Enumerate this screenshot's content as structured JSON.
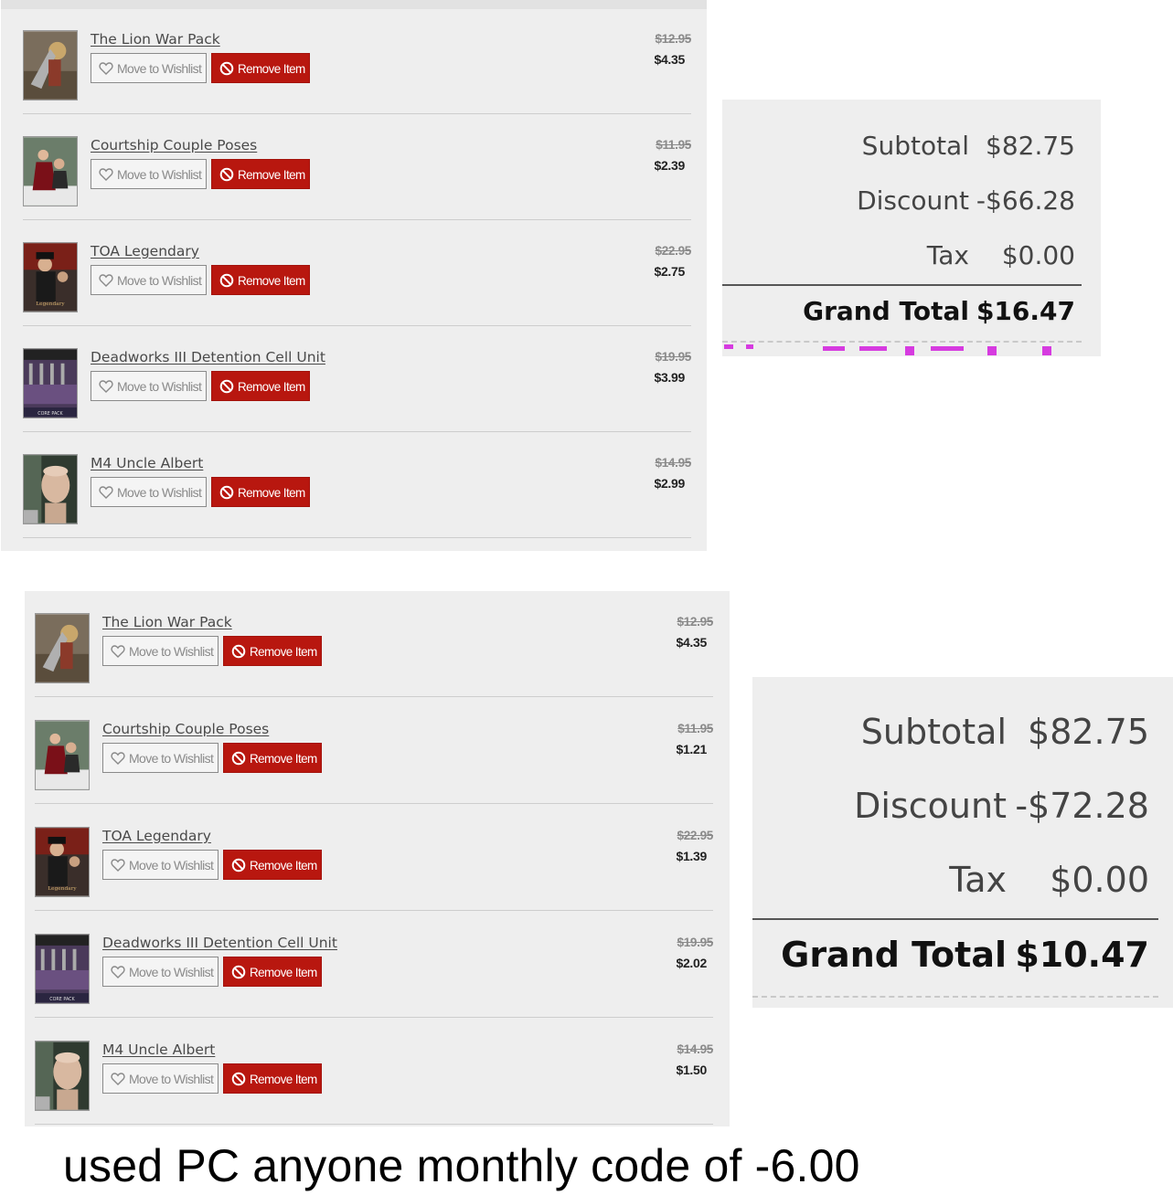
{
  "carts": [
    {
      "items": [
        {
          "title": "The Lion War Pack",
          "original_price": "$12.95",
          "sale_price": "$4.35",
          "thumb": "lion-war-thumb"
        },
        {
          "title": "Courtship Couple Poses",
          "original_price": "$11.95",
          "sale_price": "$2.39",
          "thumb": "courtship-thumb"
        },
        {
          "title": "TOA Legendary",
          "original_price": "$22.95",
          "sale_price": "$2.75",
          "thumb": "toa-thumb"
        },
        {
          "title": "Deadworks III Detention Cell Unit",
          "original_price": "$19.95",
          "sale_price": "$3.99",
          "thumb": "deadworks-thumb"
        },
        {
          "title": "M4 Uncle Albert",
          "original_price": "$14.95",
          "sale_price": "$2.99",
          "thumb": "albert-thumb"
        }
      ]
    },
    {
      "items": [
        {
          "title": "The Lion War Pack",
          "original_price": "$12.95",
          "sale_price": "$4.35",
          "thumb": "lion-war-thumb"
        },
        {
          "title": "Courtship Couple Poses",
          "original_price": "$11.95",
          "sale_price": "$1.21",
          "thumb": "courtship-thumb"
        },
        {
          "title": "TOA Legendary",
          "original_price": "$22.95",
          "sale_price": "$1.39",
          "thumb": "toa-thumb"
        },
        {
          "title": "Deadworks III Detention Cell Unit",
          "original_price": "$19.95",
          "sale_price": "$2.02",
          "thumb": "deadworks-thumb"
        },
        {
          "title": "M4 Uncle Albert",
          "original_price": "$14.95",
          "sale_price": "$1.50",
          "thumb": "albert-thumb"
        }
      ]
    }
  ],
  "buttons": {
    "wishlist_label": "Move to Wishlist",
    "remove_label": "Remove Item",
    "wishlist_icon": "heart-icon",
    "remove_icon": "ban-icon"
  },
  "totals": [
    {
      "subtotal_label": "Subtotal",
      "subtotal": "$82.75",
      "discount_label": "Discount",
      "discount": "-$66.28",
      "tax_label": "Tax",
      "tax": "$0.00",
      "grand_total_label": "Grand Total",
      "grand_total": "$16.47"
    },
    {
      "subtotal_label": "Subtotal",
      "subtotal": "$82.75",
      "discount_label": "Discount",
      "discount": "-$72.28",
      "tax_label": "Tax",
      "tax": "$0.00",
      "grand_total_label": "Grand Total",
      "grand_total": "$10.47"
    }
  ],
  "caption": "used PC anyone monthly code of -6.00",
  "colors": {
    "panel_bg": "#eeeeee",
    "remove_button": "#b8170f",
    "promo_bleed": "#d63be0"
  }
}
